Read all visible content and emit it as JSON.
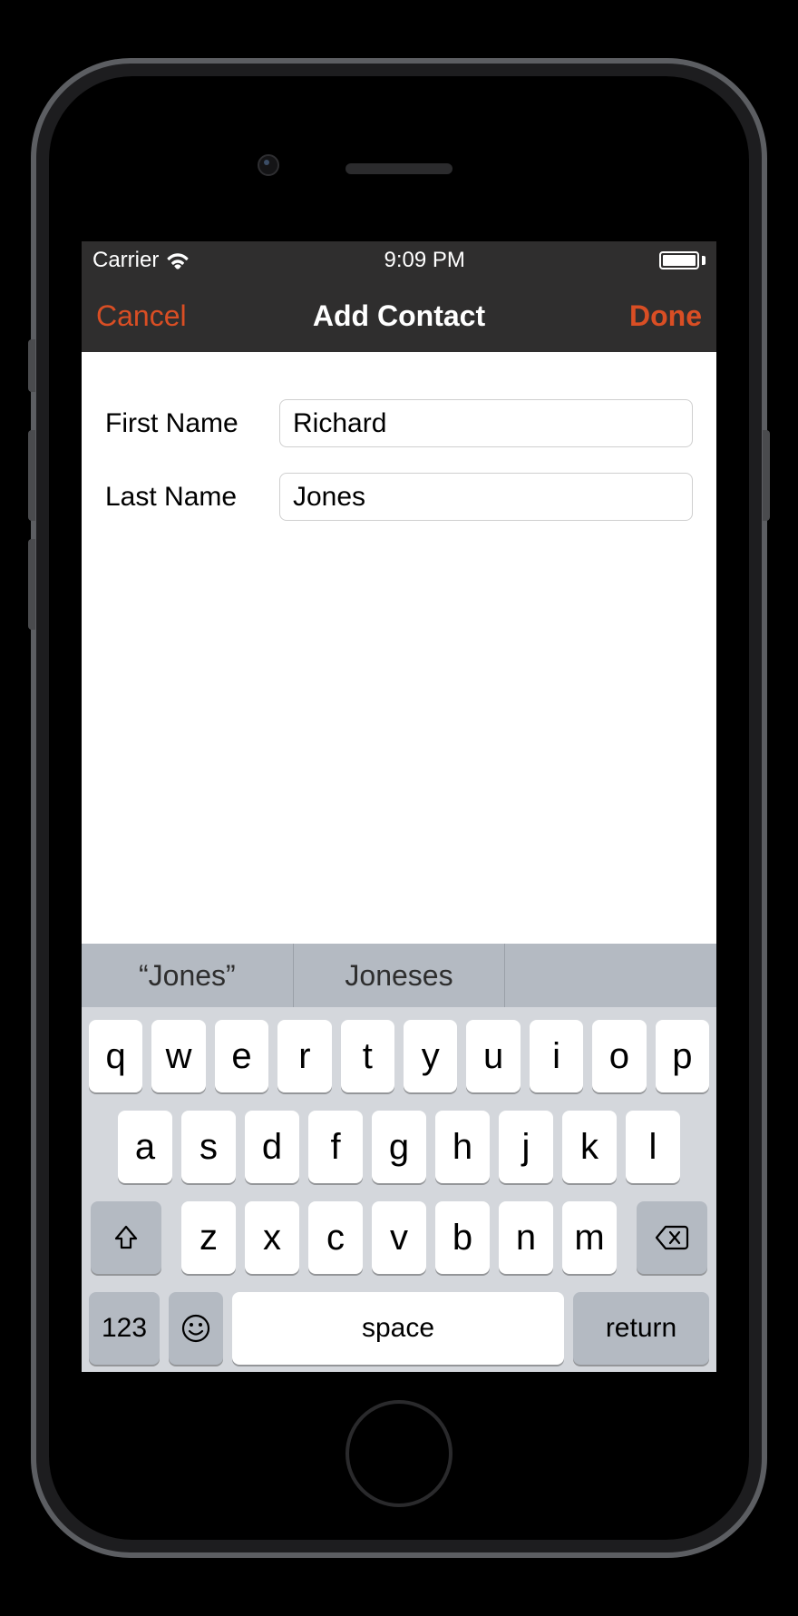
{
  "statusbar": {
    "carrier": "Carrier",
    "time": "9:09 PM"
  },
  "navbar": {
    "cancel": "Cancel",
    "title": "Add Contact",
    "done": "Done"
  },
  "form": {
    "first_name_label": "First Name",
    "first_name_value": "Richard",
    "last_name_label": "Last Name",
    "last_name_value": "Jones"
  },
  "predictive": {
    "items": [
      "“Jones”",
      "Joneses",
      ""
    ]
  },
  "keyboard": {
    "row1": [
      "q",
      "w",
      "e",
      "r",
      "t",
      "y",
      "u",
      "i",
      "o",
      "p"
    ],
    "row2": [
      "a",
      "s",
      "d",
      "f",
      "g",
      "h",
      "j",
      "k",
      "l"
    ],
    "row3": [
      "z",
      "x",
      "c",
      "v",
      "b",
      "n",
      "m"
    ],
    "num_label": "123",
    "space_label": "space",
    "return_label": "return"
  }
}
